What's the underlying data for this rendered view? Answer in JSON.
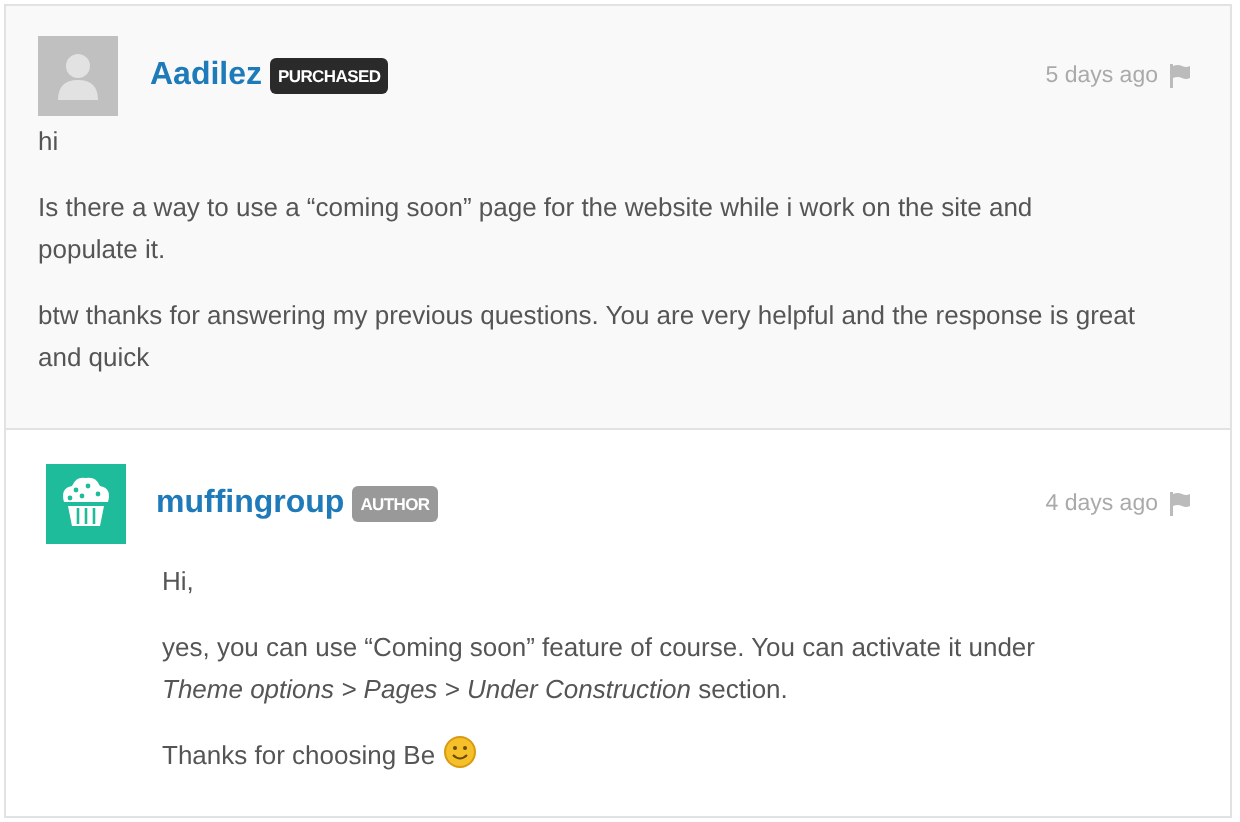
{
  "comments": [
    {
      "kind": "question",
      "author": "Aadilez",
      "avatar": {
        "kind": "default"
      },
      "badge": {
        "label": "PURCHASED",
        "kind": "purchased"
      },
      "time": "5 days ago",
      "paragraphs": [
        "hi",
        "Is there a way to use a “coming soon” page for the website while i work on the site and populate it.",
        "btw thanks for answering my previous questions. You are very helpful and the response is great and quick"
      ],
      "smiley": false
    },
    {
      "kind": "reply",
      "author": "muffingroup",
      "avatar": {
        "kind": "muffin"
      },
      "badge": {
        "label": "AUTHOR",
        "kind": "author"
      },
      "time": "4 days ago",
      "paragraphs": [
        "Hi,",
        "yes, you can use “Coming soon” feature of course. You can activate it under *Theme options > Pages > Under Construction* section.",
        "Thanks for choosing Be"
      ],
      "smiley": true
    }
  ]
}
